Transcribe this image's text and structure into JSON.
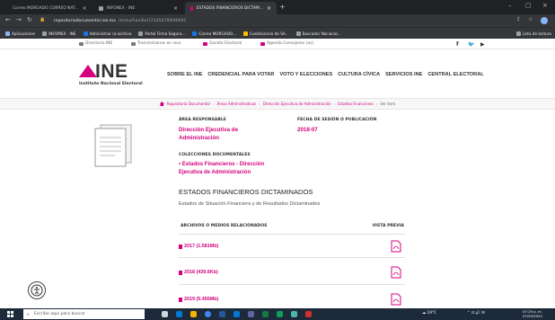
{
  "browser": {
    "tabs": [
      {
        "label": "Correo MORGADO CORREO NAT...",
        "active": false
      },
      {
        "label": "INFONEX - INE",
        "active": false
      },
      {
        "label": "ESTADOS FINANCIEROS DICTAM...",
        "active": true
      }
    ],
    "new_tab": "+",
    "url_host": "repositoriodocumental.ine.mx",
    "url_path": "/xmlui/handle/123456789/96691",
    "bookmarks": [
      {
        "label": "Aplicaciones",
        "color": "#8ab4f8"
      },
      {
        "label": "INFOMEX - INE",
        "color": "#9aa0a6"
      },
      {
        "label": "Administrar (e-archivo",
        "color": "#1a73e8"
      },
      {
        "label": "Portal Firma Segura...",
        "color": "#9aa0a6"
      },
      {
        "label": "Correo MORGADO...",
        "color": "#1a73e8"
      },
      {
        "label": "Cuestionario de SA...",
        "color": "#fbbc04"
      },
      {
        "label": "Buscador Nacional...",
        "color": "#9aa0a6"
      }
    ],
    "reading_list": "Lista de lectura"
  },
  "site": {
    "topbar": [
      {
        "label": "Directorio INE"
      },
      {
        "label": "Transmisiones en vivo"
      },
      {
        "label": "Gaceta Electoral"
      },
      {
        "label": "Agenda Consejeros (as)"
      }
    ],
    "logo_text": "INE",
    "logo_sub": "Instituto Nacional Electoral",
    "nav": [
      "SOBRE EL INE",
      "CREDENCIAL PARA VOTAR",
      "VOTO Y ELECCIONES",
      "CULTURA CÍVICA",
      "SERVICIOS INE",
      "CENTRAL ELECTORAL"
    ],
    "breadcrumb": [
      "Repositorio Documental",
      "Áreas Administrativas",
      "Dirección Ejecutiva de Administración",
      "Estados Financieros"
    ],
    "breadcrumb_current": "Ver ítem"
  },
  "item": {
    "area_label": "ÁREA RESPONSABLE",
    "area_line1": "Dirección Ejecutiva de",
    "area_line2": "Administración",
    "date_label": "FECHA DE SESIÓN O PUBLICACIÓN",
    "date_value": "2018-07",
    "coll_label": "COLECCIONES DOCUMENTALES",
    "coll_line1": "• Estados Financieros - Dirección",
    "coll_line2": "Ejecutiva de Administración",
    "title": "ESTADOS FINANCIEROS DICTAMINADOS",
    "subtitle": "Estados de Situación Financiera y de Resultados Dictaminados",
    "col_files": "ARCHIVOS O MEDIOS RELACIONADOS",
    "col_preview": "VISTA PREVIA",
    "files": [
      {
        "label": "2017 (1.581Mb)"
      },
      {
        "label": "2018 (439.6Kb)"
      },
      {
        "label": "2019 (5.456Mb)"
      }
    ]
  },
  "taskbar": {
    "search_placeholder": "Escribe aquí para buscar",
    "weather": "19°C",
    "time": "07:29 p. m.",
    "date": "07/03/2022"
  },
  "colors": {
    "brand": "#d5007f"
  }
}
